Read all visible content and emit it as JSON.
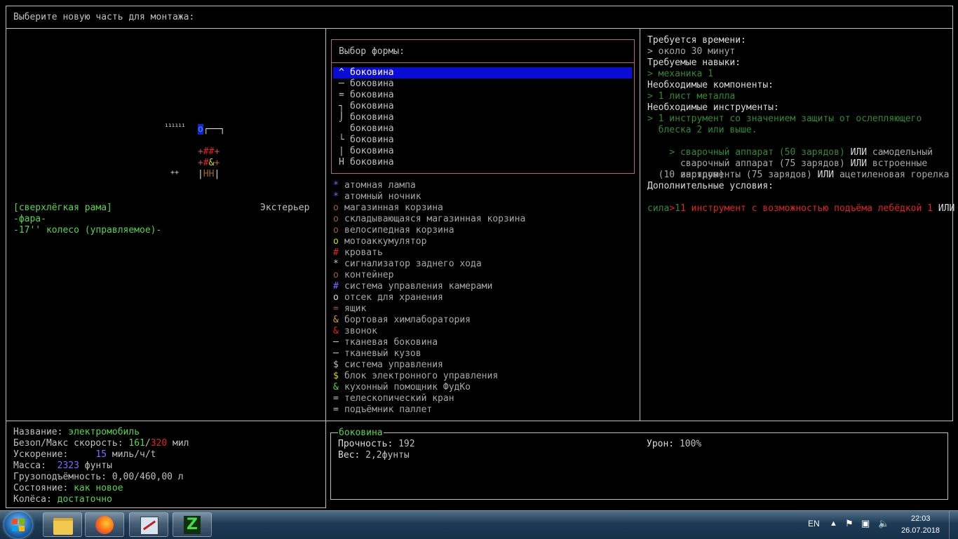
{
  "header": {
    "title": "Выберите новую часть для монтажа:"
  },
  "vehicle_map": {
    "row1": {
      "a": "o",
      "b": "┌──┐"
    },
    "row1b": "ıııııı",
    "row2": {
      "a": "+",
      "b": "##",
      "c": "+"
    },
    "row3": {
      "a": "+",
      "b": "#",
      "c": "&",
      "d": "+"
    },
    "row4": {
      "a": "|",
      "b": "HH",
      "c": "|"
    },
    "row5": "++"
  },
  "parts": {
    "items": [
      {
        "text": "[сверхлёгкая рама]",
        "color": "#56d64a"
      },
      {
        "text": "-фара-",
        "color": "#56d64a"
      },
      {
        "text": "-17'' колесо (управляемое)-",
        "color": "#56d64a"
      }
    ],
    "location_label": "Экстерьер"
  },
  "shape_dialog": {
    "title": "Выбор формы:",
    "options": [
      {
        "symbol": "^",
        "label": "боковина"
      },
      {
        "symbol": "─",
        "label": "боковина"
      },
      {
        "symbol": "=",
        "label": "боковина"
      },
      {
        "symbol": "┐",
        "label": "боковина"
      },
      {
        "symbol": "⌡",
        "label": "боковина"
      },
      {
        "symbol": "",
        "label": "боковина"
      },
      {
        "symbol": "└",
        "label": "боковина"
      },
      {
        "symbol": "|",
        "label": "боковина"
      },
      {
        "symbol": "H",
        "label": "боковина"
      }
    ]
  },
  "part_list": [
    {
      "symbol": "*",
      "symbol_color": "#6f72ff",
      "label": "атомная лампа"
    },
    {
      "symbol": "*",
      "symbol_color": "#6f72ff",
      "label": "атомный ночник"
    },
    {
      "symbol": "o",
      "symbol_color": "#a0602a",
      "label": "магазинная корзина"
    },
    {
      "symbol": "o",
      "symbol_color": "#a0602a",
      "label": "складывающаяся магазинная корзина"
    },
    {
      "symbol": "o",
      "symbol_color": "#a0602a",
      "label": "велосипедная корзина"
    },
    {
      "symbol": "o",
      "symbol_color": "#d8d800",
      "label": "мотоаккумулятор"
    },
    {
      "symbol": "#",
      "symbol_color": "#e62020",
      "label": "кровать"
    },
    {
      "symbol": "*",
      "symbol_color": "#c0c0c0",
      "label": "сигнализатор заднего хода"
    },
    {
      "symbol": "o",
      "symbol_color": "#a0602a",
      "label": "контейнер"
    },
    {
      "symbol": "#",
      "symbol_color": "#6f72ff",
      "label": "система управления камерами"
    },
    {
      "symbol": "o",
      "symbol_color": "#dcdcdc",
      "label": "отсек для хранения"
    },
    {
      "symbol": "=",
      "symbol_color": "#a0602a",
      "label": "ящик"
    },
    {
      "symbol": "&",
      "symbol_color": "#d8a020",
      "label": "бортовая химлаборатория"
    },
    {
      "symbol": "&",
      "symbol_color": "#e62020",
      "label": "звонок"
    },
    {
      "symbol": "─",
      "symbol_color": "#c0c0c0",
      "label": "тканевая боковина"
    },
    {
      "symbol": "─",
      "symbol_color": "#c0c0c0",
      "label": "тканевый кузов"
    },
    {
      "symbol": "$",
      "symbol_color": "#c0c0c0",
      "label": "система управления"
    },
    {
      "symbol": "$",
      "symbol_color": "#d8d800",
      "label": "блок электронного управления"
    },
    {
      "symbol": "&",
      "symbol_color": "#56d64a",
      "label": "кухонный помощник ФудКо"
    },
    {
      "symbol": "=",
      "symbol_color": "#c0c0c0",
      "label": "телескопический кран"
    },
    {
      "symbol": "=",
      "symbol_color": "#c0c0c0",
      "label": "подъёмник паллет"
    }
  ],
  "requirements": {
    "time_label": "Требуется времени:",
    "time_value": "> около 30 минут",
    "skills_label": "Требуемые навыки:",
    "skills_value": "> механика 1",
    "components_label": "Необходимые компоненты:",
    "components_value": "> 1 лист металла",
    "tools_label": "Необходимые инструменты:",
    "tool1_line1": "> 1 инструмент со значением защиты от ослепляющего",
    "tool1_line2": "  блеска 2 или выше.",
    "tool2_a": "> сварочный аппарат (50 зарядов)",
    "tool2_or1": " ИЛИ ",
    "tool2_b": "самодельный",
    "tool2_c": "  сварочный аппарат (75 зарядов)",
    "tool2_or2": " ИЛИ ",
    "tool2_d": "встроенные",
    "tool2_e": "  инструменты (75 зарядов)",
    "tool2_or3": " ИЛИ ",
    "tool2_f": "ацетиленовая горелка",
    "tool2_g": "  (10 зарядов)",
    "extra_label": "Дополнительные условия:",
    "extra_a": "> 1 инструмент с возможностью подъёма лебёдкой 1",
    "extra_or": " ИЛИ",
    "extra_b": "сила 1"
  },
  "vehicle_stats": {
    "name_label": "Название: ",
    "name_value": "электромобиль",
    "speed_label": "Безоп/Макс скорость: ",
    "speed_safe": "161",
    "speed_sep": "/",
    "speed_max": "320",
    "speed_unit": " мил",
    "accel_label": "Ускорение:     ",
    "accel_value": "15",
    "accel_unit": " миль/ч/t",
    "mass_label": "Масса:  ",
    "mass_value": "2323",
    "mass_unit": " фунты",
    "cargo_label": "Грузоподъёмность: ",
    "cargo_value": "0,00/460,00 л",
    "status_label": "Состояние: ",
    "status_value": "как новое",
    "wheels_label": "Колёса: ",
    "wheels_value": "достаточно"
  },
  "part_info": {
    "title": "боковина",
    "durability_label": "Прочность: ",
    "durability_value": "192",
    "weight_label": "Вес: ",
    "weight_value": "2,2фунты",
    "damage_label": "Урон: ",
    "damage_value": "100%"
  },
  "taskbar": {
    "lang": "EN",
    "time": "22:03",
    "date": "26.07.2018"
  }
}
